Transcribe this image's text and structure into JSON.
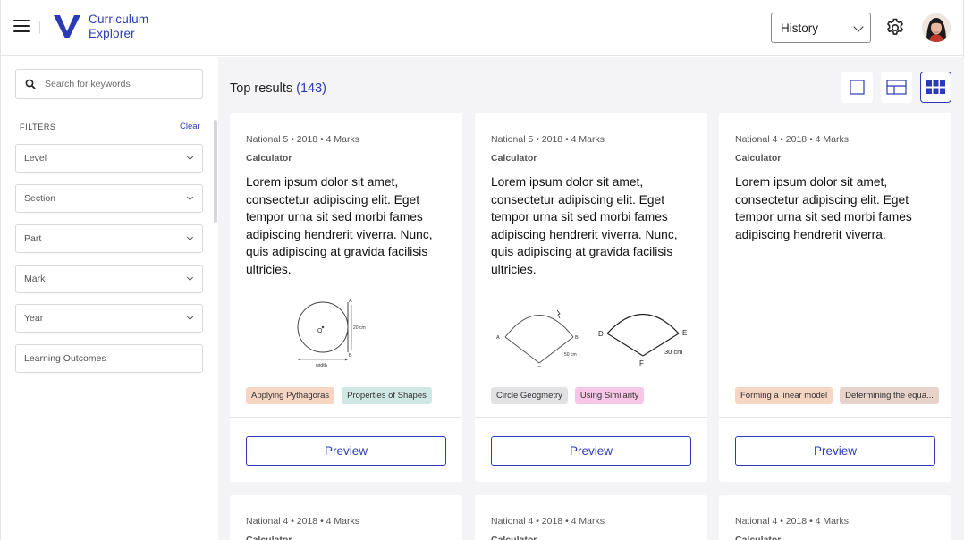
{
  "header": {
    "brand_line1": "Curriculum",
    "brand_line2": "Explorer",
    "subject_select": "History"
  },
  "sidebar": {
    "search_placeholder": "Search for keywords",
    "filters_label": "FILTERS",
    "clear_label": "Clear",
    "filters": [
      "Level",
      "Section",
      "Part",
      "Mark",
      "Year"
    ],
    "learning_outcomes": "Learning Outcomes"
  },
  "main": {
    "results_label": "Top results",
    "results_count": "(143)",
    "view_modes": [
      "single-view",
      "split-view",
      "grid-view"
    ],
    "active_view": "grid-view"
  },
  "cards": [
    {
      "meta": "National 5 • 2018 • 4 Marks",
      "type": "Calculator",
      "body": "Lorem ipsum dolor sit amet, consectetur adipiscing elit. Eget tempor urna sit sed morbi fames adipiscing hendrerit viverra. Nunc, quis adipiscing at gravida facilisis ultricies.",
      "figure_labels": {
        "a": "A",
        "b": "B",
        "o": "O",
        "height": "20 cm",
        "width": "width"
      },
      "tags": [
        {
          "label": "Applying Pythagoras",
          "color": "#f6d5c3"
        },
        {
          "label": "Properties of Shapes",
          "color": "#cfe8e3"
        }
      ],
      "preview": "Preview"
    },
    {
      "meta": "National 5 • 2018 • 4 Marks",
      "type": "Calculator",
      "body": "Lorem ipsum dolor sit amet, consectetur adipiscing elit. Eget tempor urna sit sed morbi fames adipiscing hendrerit viverra. Nunc, quis adipiscing at gravida facilisis ultricies.",
      "figure_labels": {
        "a": "A",
        "b": "B",
        "c": "C",
        "len": "50 cm",
        "d": "D",
        "e": "E",
        "f": "F",
        "len2": "30 cm"
      },
      "tags": [
        {
          "label": "Circle Geogmetry",
          "color": "#e2e2e4"
        },
        {
          "label": "Using Similarity",
          "color": "#f7c6e6"
        }
      ],
      "preview": "Preview"
    },
    {
      "meta": "National 4 • 2018 • 4 Marks",
      "type": "Calculator",
      "body": "Lorem ipsum dolor sit amet, consectetur adipiscing elit. Eget tempor urna sit sed morbi fames adipiscing hendrerit viverra.",
      "tags": [
        {
          "label": "Forming a linear model",
          "color": "#f6d5c3"
        },
        {
          "label": "Determining the equa...",
          "color": "#e7d3c9"
        }
      ],
      "preview": "Preview"
    },
    {
      "meta": "National 4 • 2018 • 4 Marks",
      "type": "Calculator"
    },
    {
      "meta": "National 4 • 2018 • 4 Marks",
      "type": "Calculator"
    },
    {
      "meta": "National 4 • 2018 • 4 Marks",
      "type": "Calculator"
    }
  ],
  "colors": {
    "accent": "#2b3bb5",
    "page_bg": "#f4f4f6"
  }
}
